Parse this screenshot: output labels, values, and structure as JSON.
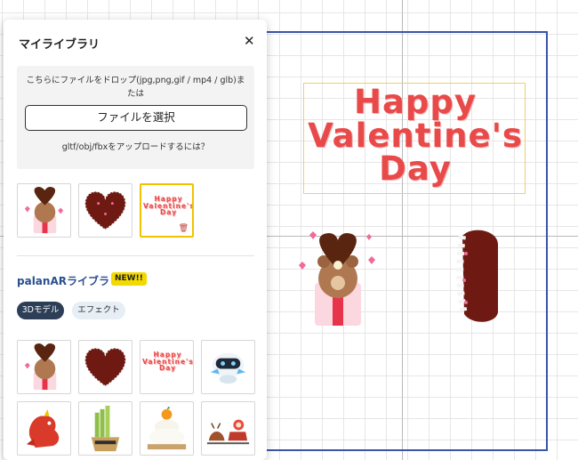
{
  "panel": {
    "title": "マイライブラリ",
    "close_symbol": "✕",
    "drop_text": "こちらにファイルをドロップ(jpg,png,gif / mp4 / glb)または",
    "select_button": "ファイルを選択",
    "upload_help": "gltf/obj/fbxをアップロードするには？",
    "my_items": [
      {
        "name": "teddy-bear-gift"
      },
      {
        "name": "heart-cookie"
      },
      {
        "name": "happy-valentines-day-text",
        "selected": true
      }
    ],
    "library_title": "palanARライブラリ",
    "new_badge": "NEW!!",
    "tabs": [
      {
        "label": "3Dモデル",
        "active": true
      },
      {
        "label": "エフェクト",
        "active": false
      }
    ],
    "library_items": [
      {
        "name": "teddy-bear-gift"
      },
      {
        "name": "heart-cookie"
      },
      {
        "name": "happy-valentines-day-text"
      },
      {
        "name": "robot"
      },
      {
        "name": "red-dragon"
      },
      {
        "name": "kadomatsu"
      },
      {
        "name": "kagami-mochi"
      },
      {
        "name": "santa-sleigh"
      }
    ]
  },
  "canvas": {
    "text_line1": "Happy",
    "text_line2": "Valentine's",
    "text_line3": "Day",
    "colors": {
      "frame": "#3a55a8",
      "text": "#e84a4a",
      "selection": "#f0cf6b"
    }
  }
}
